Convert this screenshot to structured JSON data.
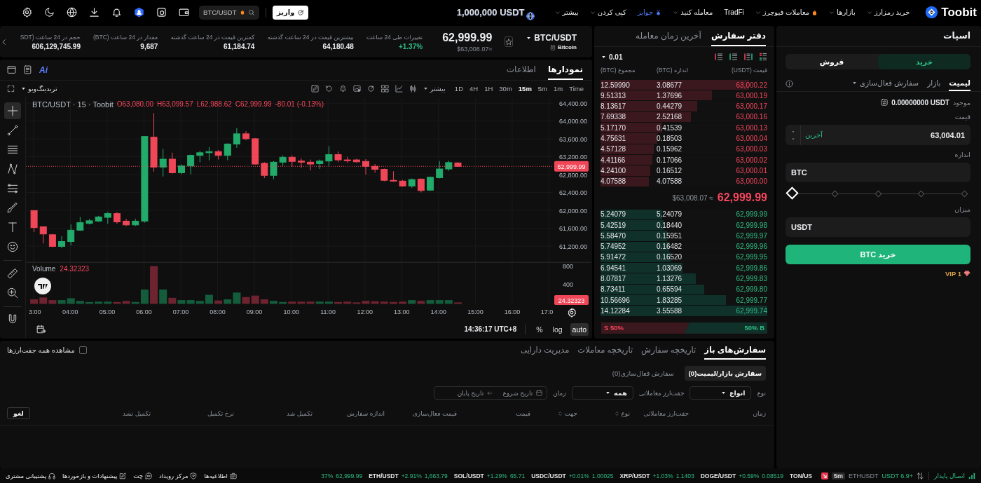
{
  "top_nav": {
    "logo": "Toobit",
    "menu": [
      {
        "label": "خرید رمزارز",
        "kind": "normal",
        "dropdown": true
      },
      {
        "label": "بازارها",
        "kind": "normal",
        "dropdown": true
      },
      {
        "label": "معاملات فیوچرز",
        "kind": "hot",
        "dropdown": true
      },
      {
        "label": "TradFi",
        "kind": "normal",
        "dropdown": false
      },
      {
        "label": "معامله کنید",
        "kind": "normal",
        "dropdown": true
      },
      {
        "label": "جوایز",
        "kind": "reward",
        "dropdown": false
      },
      {
        "label": "کپی کردن",
        "kind": "normal",
        "dropdown": true
      },
      {
        "label": "بیشتر",
        "kind": "normal",
        "dropdown": true
      }
    ],
    "promo": "1,000,000 USDT",
    "deposit": "واریز",
    "search": {
      "placeholder": "BTC/USDT"
    }
  },
  "ticker": {
    "pair": "BTC/USDT",
    "name": "Bitcoin",
    "favorite": false,
    "price": "62,999.99",
    "fiat": "$63,008.07≈",
    "stats": [
      {
        "label": "تغییرات طی 24 ساعت",
        "value": "+1.37%",
        "rising": true
      },
      {
        "label": "بیشترین قیمت در 24 ساعت گذشته",
        "value": "64,180.48"
      },
      {
        "label": "کمترین قیمت در 24 ساعت گذشته",
        "value": "61,184.74"
      },
      {
        "label": "مقدار در 24 ساعت (BTC)",
        "value": "9,687"
      },
      {
        "label": "حجم در 24 ساعت (SDT",
        "value": "606,129,745.99"
      }
    ]
  },
  "chart_panel": {
    "tabs": [
      {
        "label": "نمودارها",
        "selected": true
      },
      {
        "label": "اطلاعات",
        "selected": false
      }
    ],
    "ai_label": "Ai",
    "intervals": [
      {
        "label": "Time",
        "selected": false
      },
      {
        "label": "1m",
        "selected": false
      },
      {
        "label": "5m",
        "selected": false
      },
      {
        "label": "15m",
        "selected": true
      },
      {
        "label": "30m",
        "selected": false
      },
      {
        "label": "1H",
        "selected": false
      },
      {
        "label": "4H",
        "selected": false
      },
      {
        "label": "1D",
        "selected": false
      }
    ],
    "more": "بیشتر",
    "chart_menu": "تریدینگ‌ویو",
    "tools": [
      {
        "selected": true
      },
      {
        "selected": false
      },
      {
        "selected": false
      },
      {
        "selected": false
      },
      {
        "selected": false
      },
      {
        "selected": false
      },
      {
        "selected": false
      },
      {
        "selected": false
      },
      {
        "selected": false
      },
      {
        "selected": false
      },
      {
        "selected": false
      }
    ],
    "legend": {
      "falling": true,
      "change": "-80.01 (-0.13%)",
      "values": [
        "C62,999.99",
        "L62,988.62",
        "H63,099.57",
        "O63,080.00"
      ],
      "title": "BTC/USDT · 15 · Toobit"
    },
    "price_axis": [
      "64,400.00",
      "64,000.00",
      "63,600.00",
      "63,200.00",
      "62,800.00",
      "62,400.00",
      "62,000.00",
      "61,600.00",
      "61,200.00"
    ],
    "last_price": "62,999.99",
    "volume": {
      "label": "Volume",
      "value": "24.32323",
      "axis": [
        "800",
        "400"
      ],
      "last": "24.32323"
    },
    "time_axis": [
      "17:0",
      "16:00",
      "15:00",
      "14:00",
      "13:00",
      "12:00",
      "11:00",
      "10:00",
      "09:00",
      "08:00",
      "07:00",
      "06:00",
      "05:00",
      "04:00",
      "3:00"
    ],
    "clock": "14:36:17 UTC+8",
    "scale_modes": [
      {
        "label": "auto",
        "selected": true
      },
      {
        "label": "log",
        "selected": false
      },
      {
        "label": "%",
        "selected": false
      }
    ]
  },
  "order_book": {
    "tabs": [
      {
        "label": "دفتر سفارش",
        "selected": true
      },
      {
        "label": "آخرین زمان معامله",
        "selected": false
      }
    ],
    "precision": "0.01",
    "columns": [
      "قیمت (USDT)",
      "اندازه (BTC)",
      "مجموع (BTC)"
    ],
    "asks": [
      {
        "price": "63,000.22",
        "size": "3.08677",
        "total": "12.59990",
        "level": 0.89
      },
      {
        "price": "63,000.19",
        "size": "1.37696",
        "total": "9.51313",
        "level": 0.67
      },
      {
        "price": "63,000.17",
        "size": "0.44279",
        "total": "8.13617",
        "level": 0.58
      },
      {
        "price": "63,000.16",
        "size": "2.52168",
        "total": "7.69338",
        "level": 0.54
      },
      {
        "price": "63,000.13",
        "size": "0.41539",
        "total": "5.17170",
        "level": 0.37
      },
      {
        "price": "63,000.04",
        "size": "0.18503",
        "total": "4.75631",
        "level": 0.34
      },
      {
        "price": "63,000.03",
        "size": "0.15962",
        "total": "4.57128",
        "level": 0.32
      },
      {
        "price": "63,000.02",
        "size": "0.17066",
        "total": "4.41166",
        "level": 0.31
      },
      {
        "price": "63,000.01",
        "size": "0.16512",
        "total": "4.24100",
        "level": 0.3
      },
      {
        "price": "63,000.00",
        "size": "4.07588",
        "total": "4.07588",
        "level": 0.29
      }
    ],
    "last": {
      "price": "62,999.99",
      "fiat": "$63,008.07 ≈"
    },
    "bids": [
      {
        "price": "62,999.99",
        "size": "5.24079",
        "total": "5.24079",
        "level": 0.37
      },
      {
        "price": "62,999.98",
        "size": "0.18440",
        "total": "5.42519",
        "level": 0.38
      },
      {
        "price": "62,999.97",
        "size": "0.15951",
        "total": "5.58470",
        "level": 0.4
      },
      {
        "price": "62,999.96",
        "size": "0.16482",
        "total": "5.74952",
        "level": 0.41
      },
      {
        "price": "62,999.95",
        "size": "0.16520",
        "total": "5.91472",
        "level": 0.42
      },
      {
        "price": "62,999.86",
        "size": "1.03069",
        "total": "6.94541",
        "level": 0.49
      },
      {
        "price": "62,999.83",
        "size": "1.13276",
        "total": "8.07817",
        "level": 0.57
      },
      {
        "price": "62,999.80",
        "size": "0.65594",
        "total": "8.73411",
        "level": 0.62
      },
      {
        "price": "62,999.77",
        "size": "1.83285",
        "total": "10.56696",
        "level": 0.75
      },
      {
        "price": "62,999.74",
        "size": "3.55588",
        "total": "14.12284",
        "level": 1
      }
    ],
    "ratio": {
      "buy": "50% B",
      "sell": "S 50%",
      "level": 0.5
    }
  },
  "trade_panel": {
    "title": "اسپات",
    "sides": [
      {
        "label": "خرید",
        "selected": true
      },
      {
        "label": "فروش",
        "selected": false
      }
    ],
    "order_types": [
      {
        "label": "لیمیت",
        "selected": true,
        "dropdown": false
      },
      {
        "label": "بازار",
        "selected": false,
        "dropdown": false
      },
      {
        "label": "سفارش فعال‌سازی",
        "selected": false,
        "dropdown": true
      }
    ],
    "available": {
      "label": "موجود",
      "value": "0.00000000 USDT"
    },
    "price": {
      "label": "قیمت",
      "tag": "آخرین",
      "value": "63,004.01"
    },
    "size": {
      "label": "اندازه",
      "unit": "BTC"
    },
    "slider": {
      "level": 0
    },
    "amount": {
      "label": "میزان",
      "unit": "USDT"
    },
    "submit": "خرید BTC",
    "vip": "VIP 1"
  },
  "orders_panel": {
    "tabs": [
      {
        "label": "سفارش‌های باز",
        "selected": true
      },
      {
        "label": "تاریخچه سفارش",
        "selected": false
      },
      {
        "label": "تاریخچه معاملات",
        "selected": false
      },
      {
        "label": "مدیریت دارایی",
        "selected": false
      }
    ],
    "show_all": {
      "label": "مشاهده همه جفت‌ارزها",
      "checked": false
    },
    "sub_tabs": [
      {
        "label": "سفارش بازار/لیمیت(0)",
        "selected": true
      },
      {
        "label": "سفارش فعال‌سازی(0)",
        "selected": false
      }
    ],
    "filters": [
      {
        "label": "نوع",
        "value": "انواع"
      },
      {
        "label": "جفت‌ارز معاملاتی",
        "value": "همه"
      }
    ],
    "time_filter": {
      "label": "زمان",
      "start_placeholder": "تاریخ شروع",
      "end_placeholder": "تاریخ پایان"
    },
    "columns": [
      {
        "label": "زمان",
        "sortable": false
      },
      {
        "label": "جفت‌ارز معاملاتی",
        "sortable": false
      },
      {
        "label": "نوع",
        "sortable": true
      },
      {
        "label": "جهت",
        "sortable": true
      },
      {
        "label": "قیمت",
        "sortable": false
      },
      {
        "label": "قیمت فعال‌سازی",
        "sortable": false
      },
      {
        "label": "اندازه سفارش",
        "sortable": false
      },
      {
        "label": "تکمیل شد",
        "sortable": false
      },
      {
        "label": "نرخ تکمیل",
        "sortable": false
      },
      {
        "label": "تکمیل نشد",
        "sortable": false
      }
    ],
    "cancel_all": "لغو"
  },
  "status_bar": {
    "connection": "اتصال پایدار",
    "alert": {
      "change": "USDT 6.9+",
      "pair": "ETHUSDT",
      "interval": "5m"
    },
    "tickers": [
      {
        "pair": "TON/US"
      },
      {
        "pair": "DOGE/USDT",
        "change": "+0.59%",
        "price": "0.08519",
        "rising": true
      },
      {
        "pair": "XRP/USDT",
        "change": "+1.03%",
        "price": "1.1403",
        "rising": true
      },
      {
        "pair": "USDC/USDT",
        "change": "+0.01%",
        "price": "1.00025",
        "rising": true
      },
      {
        "pair": "SOL/USDT",
        "change": "+1.29%",
        "price": "65.71",
        "rising": true
      },
      {
        "pair": "ETH/USDT",
        "change": "+2.91%",
        "price": "1,663.79",
        "rising": true
      },
      {
        "change": "37%",
        "price": "62,999.99",
        "rising": true
      }
    ],
    "links": [
      {
        "label": "اطلاعیه‌ها"
      },
      {
        "label": "مرکز رویداد"
      },
      {
        "label": "چت"
      },
      {
        "label": "پیشنهادات و بازخوردها"
      },
      {
        "label": "پشتیبانی مشتری"
      }
    ]
  }
}
